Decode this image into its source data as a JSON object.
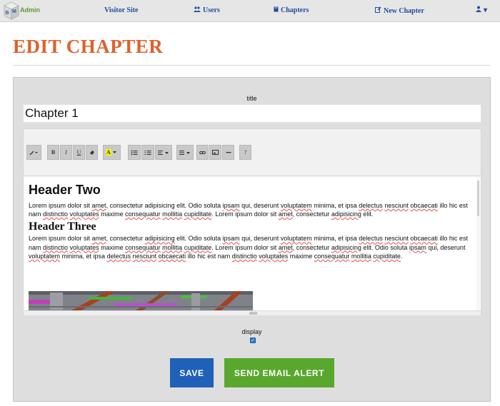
{
  "brand": {
    "letters": "BM",
    "label": "Admin"
  },
  "nav": {
    "visitor_site": "Visitor Site",
    "users": "Users",
    "chapters": "Chapters",
    "new_chapter": "New Chapter",
    "user_caret": "▾"
  },
  "icons": {
    "users": "users-icon",
    "chapters": "book-icon",
    "new_chapter": "edit-icon",
    "user_menu": "user-icon"
  },
  "page": {
    "title": "EDIT CHAPTER"
  },
  "form": {
    "title_label": "title",
    "title_value": "Chapter 1",
    "display_label": "display",
    "display_checked": true,
    "save_label": "SAVE",
    "alert_label": "SEND EMAIL ALERT"
  },
  "toolbar": {
    "buttons": [
      "✎ ▾",
      "B",
      "I",
      "U",
      "⌫",
      "A ▾",
      "• ≡",
      "1. ≡",
      "≡ ▾",
      "≣ ▾",
      "🔗",
      "▣",
      "—",
      "?"
    ]
  },
  "content": {
    "h2": "Header Two",
    "p1_parts": [
      "Lorem ipsum dolor sit ",
      "amet",
      ", consectetur adipisicing elit. Odio soluta ",
      "ipsam",
      " qui, deserunt ",
      "voluptatem",
      " minima, et ipsa ",
      "delectus",
      " ",
      "nesciunt",
      " ",
      "obcaecati",
      " illo hic est nam ",
      "distinctio",
      " ",
      "voluptates",
      " maxime ",
      "consequatur",
      " ",
      "mollitia",
      " ",
      "cupiditate",
      ". Lorem ipsum dolor sit ",
      "amet",
      ", consectetur ",
      "adipisicing",
      " elit."
    ],
    "h3": "Header Three",
    "p2_parts": [
      "Lorem ipsum dolor sit ",
      "amet",
      ", consectetur ",
      "adipisicing",
      " elit. Odio soluta ",
      "ipsam",
      " qui, deserunt ",
      "voluptatem",
      " minima, et ipsa ",
      "delectus",
      " ",
      "nesciunt",
      " ",
      "obcaecati",
      " illo hic est nam ",
      "distinctio",
      " ",
      "voluptates",
      " maxime ",
      "consequatur",
      " ",
      "mollitia",
      " ",
      "cupiditate",
      ". Lorem ipsum dolor sit ",
      "amet",
      ", consectetur ",
      "adipisicing",
      " elit. Odio soluta ",
      "ipsam",
      " qui, deserunt ",
      "voluptatem",
      " minima, et ipsa ",
      "delectus",
      " ",
      "nesciunt",
      " ",
      "obcaecati",
      " illo hic est nam ",
      "distinctio",
      " ",
      "voluptates",
      " maxime ",
      "consequatur",
      " ",
      "mollitia",
      " ",
      "cupiditate",
      "."
    ]
  },
  "colors": {
    "title": "#e0602a",
    "nav_link": "#1f4e9c",
    "save": "#1f61b8",
    "alert": "#5aa72d"
  }
}
